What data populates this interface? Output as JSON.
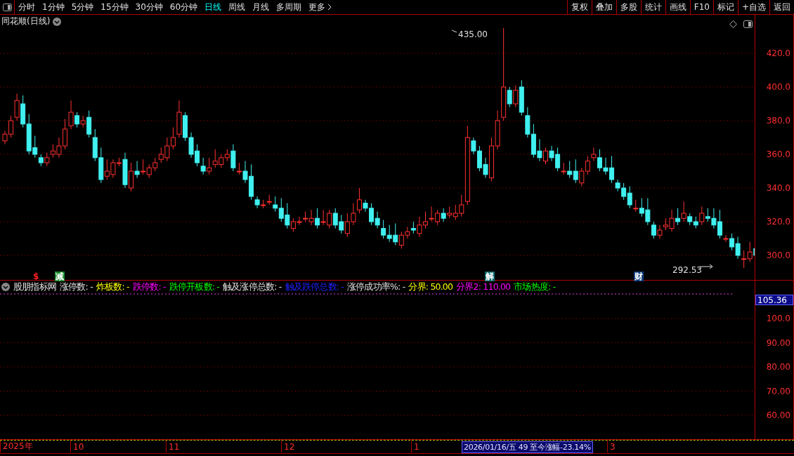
{
  "toolbar": {
    "periods": [
      {
        "label": "分时",
        "selected": false
      },
      {
        "label": "1分钟",
        "selected": false
      },
      {
        "label": "5分钟",
        "selected": false
      },
      {
        "label": "15分钟",
        "selected": false
      },
      {
        "label": "30分钟",
        "selected": false
      },
      {
        "label": "60分钟",
        "selected": false
      },
      {
        "label": "日线",
        "selected": true
      },
      {
        "label": "周线",
        "selected": false
      },
      {
        "label": "月线",
        "selected": false
      },
      {
        "label": "多周期",
        "selected": false
      },
      {
        "label": "更多",
        "selected": false
      }
    ],
    "buttons": [
      "复权",
      "叠加",
      "多股",
      "统计",
      "画线",
      "F10",
      "标记",
      "+自选",
      "返回"
    ]
  },
  "main_chart": {
    "title": "同花顺(日线)",
    "price_axis": [
      "420.0",
      "400.0",
      "380.0",
      "360.0",
      "340.0",
      "320.0",
      "300.0"
    ],
    "high_label": "435.00",
    "low_label": "292.53",
    "signals": [
      {
        "text": "$",
        "kind": "plain",
        "color": "#ff2020"
      },
      {
        "text": "减",
        "kind": "badge",
        "color": "#1a8a2a"
      },
      {
        "text": "解",
        "kind": "badge",
        "color": "#0a6a6a"
      },
      {
        "text": "财",
        "kind": "badge",
        "color": "#0c3c7c"
      }
    ]
  },
  "indicator": {
    "name": "股朋指标网",
    "legend": [
      {
        "text": "涨停数: -",
        "color": "#e0e0e0"
      },
      {
        "text": "炸板数: -",
        "color": "#ffff00"
      },
      {
        "text": "跌停数: -",
        "color": "#ff00ff"
      },
      {
        "text": "跌停开板数: -",
        "color": "#00ff00"
      },
      {
        "text": "触及涨停总数: -",
        "color": "#e0e0e0"
      },
      {
        "text": "触及跌停总数: -",
        "color": "#2020ff"
      },
      {
        "text": "涨停成功率%: -",
        "color": "#e0e0e0"
      },
      {
        "text": "分界: 50.00",
        "color": "#ffff00"
      },
      {
        "text": "分界2: 110.00",
        "color": "#ff00ff"
      },
      {
        "text": "市场热度: -",
        "color": "#00ff00"
      }
    ],
    "current_value": "105.36",
    "axis": [
      "100.0",
      "90.00",
      "80.00",
      "70.00",
      "60.00"
    ]
  },
  "date_bar": [
    {
      "text": "2025年",
      "kind": "tick"
    },
    {
      "text": "10",
      "kind": "tick"
    },
    {
      "text": "11",
      "kind": "tick"
    },
    {
      "text": "12",
      "kind": "tick"
    },
    {
      "text": "1",
      "kind": "tick"
    },
    {
      "text": "2026/01/16/五 49 至今涨幅-23.14%",
      "kind": "cursor"
    },
    {
      "text": "3",
      "kind": "tick"
    }
  ]
}
